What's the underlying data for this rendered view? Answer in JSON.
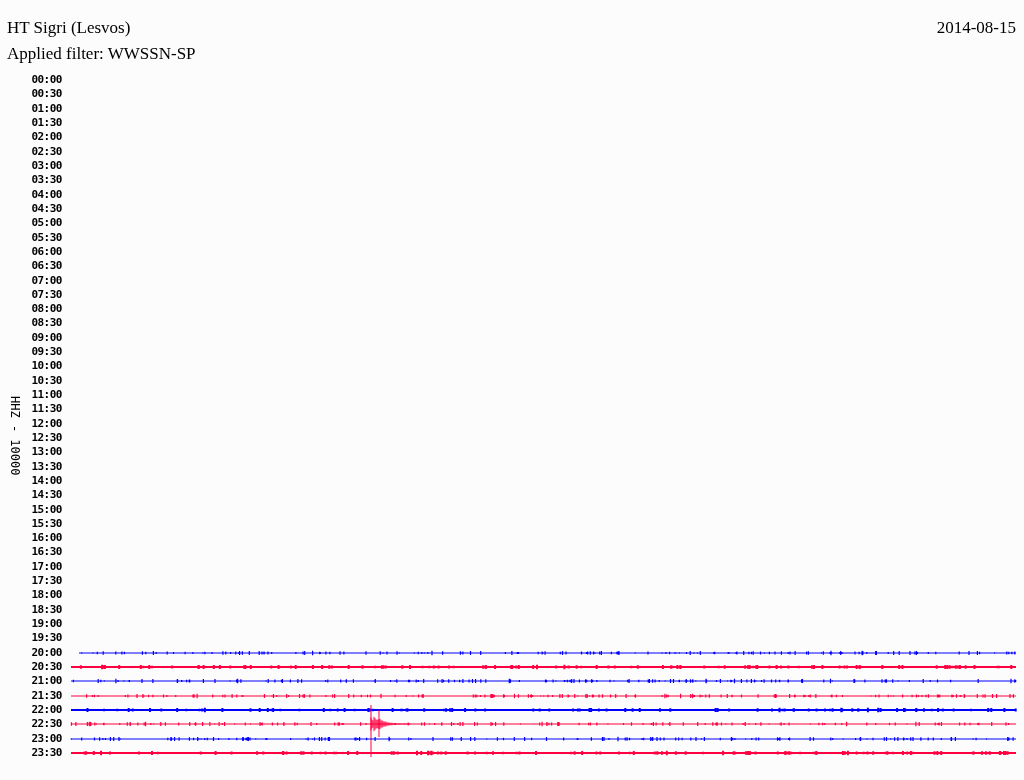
{
  "header": {
    "station": "HT Sigri (Lesvos)",
    "date": "2014-08-15"
  },
  "filter": "Applied filter: WWSSN-SP",
  "axis_label": "HHZ - 10000",
  "rows": [
    {
      "time": "00:00"
    },
    {
      "time": "00:30"
    },
    {
      "time": "01:00"
    },
    {
      "time": "01:30"
    },
    {
      "time": "02:00"
    },
    {
      "time": "02:30"
    },
    {
      "time": "03:00"
    },
    {
      "time": "03:30"
    },
    {
      "time": "04:00"
    },
    {
      "time": "04:30"
    },
    {
      "time": "05:00"
    },
    {
      "time": "05:30"
    },
    {
      "time": "06:00"
    },
    {
      "time": "06:30"
    },
    {
      "time": "07:00"
    },
    {
      "time": "07:30"
    },
    {
      "time": "08:00"
    },
    {
      "time": "08:30"
    },
    {
      "time": "09:00"
    },
    {
      "time": "09:30"
    },
    {
      "time": "10:00"
    },
    {
      "time": "10:30"
    },
    {
      "time": "11:00"
    },
    {
      "time": "11:30"
    },
    {
      "time": "12:00"
    },
    {
      "time": "12:30"
    },
    {
      "time": "13:00"
    },
    {
      "time": "13:30"
    },
    {
      "time": "14:00"
    },
    {
      "time": "14:30"
    },
    {
      "time": "15:00"
    },
    {
      "time": "15:30"
    },
    {
      "time": "16:00"
    },
    {
      "time": "16:30"
    },
    {
      "time": "17:00"
    },
    {
      "time": "17:30"
    },
    {
      "time": "18:00"
    },
    {
      "time": "18:30"
    },
    {
      "time": "19:00"
    },
    {
      "time": "19:30"
    },
    {
      "time": "20:00",
      "color": "#0000ff",
      "kind": "noise"
    },
    {
      "time": "20:30",
      "color": "#ff0040",
      "kind": "noise"
    },
    {
      "time": "21:00",
      "color": "#0000ff",
      "kind": "noise"
    },
    {
      "time": "21:30",
      "color": "#ff0040",
      "kind": "noise"
    },
    {
      "time": "22:00",
      "color": "#0000ff",
      "kind": "noise"
    },
    {
      "time": "22:30",
      "color": "#ff0040",
      "kind": "quake"
    },
    {
      "time": "23:00",
      "color": "#0000ff",
      "kind": "noise"
    },
    {
      "time": "23:30",
      "color": "#ff0040",
      "kind": "noise"
    }
  ]
}
